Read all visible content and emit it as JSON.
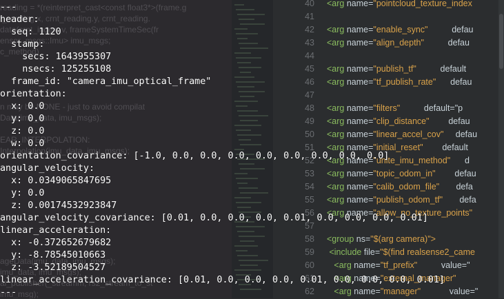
{
  "background_left_lines": [
    "reading = *(reinterpret_cast<const float3*>(frame.g",
    "t_reading.x, crnt_reading.y, crnt_reading.",
    "data(crnt_index, v, frameSystemTimeSec(fr",
    "ensor_msgs::Imu> imu_msgs;",
    "c_method)",
    "",
    "",
    "",
    "",
    "n may be NONE - just to avoid compilat",
    "Data(imu_data, imu_msgs);",
    "",
    "EAR_INTERPOLATION:",
    "Interpolation(imu_data, imu_msgs);",
    "",
    "",
    "",
    "",
    "",
    "",
    "",
    "",
    "",
    "ageData(imu_data, imu_msgs);",
    "imu_data, imu_msgs);",
    "al_publisher(_streamm, rs2_stream_to_st",
    "imu_msg);"
  ],
  "editor_right": {
    "rows": [
      {
        "n": "40",
        "parts": [
          [
            "tag",
            "<arg "
          ],
          [
            "attr",
            "name="
          ],
          [
            "val",
            "\"pointcloud_texture_index"
          ]
        ]
      },
      {
        "n": "41",
        "parts": []
      },
      {
        "n": "42",
        "parts": [
          [
            "tag",
            "<arg "
          ],
          [
            "attr",
            "name="
          ],
          [
            "val",
            "\"enable_sync\""
          ],
          [
            "attr",
            "          defau"
          ]
        ]
      },
      {
        "n": "43",
        "parts": [
          [
            "tag",
            "<arg "
          ],
          [
            "attr",
            "name="
          ],
          [
            "val",
            "\"align_depth\""
          ],
          [
            "attr",
            "          defau"
          ]
        ]
      },
      {
        "n": "44",
        "parts": []
      },
      {
        "n": "45",
        "parts": [
          [
            "tag",
            "<arg "
          ],
          [
            "attr",
            "name="
          ],
          [
            "val",
            "\"publish_tf\""
          ],
          [
            "attr",
            "          default"
          ]
        ]
      },
      {
        "n": "46",
        "parts": [
          [
            "tag",
            "<arg "
          ],
          [
            "attr",
            "name="
          ],
          [
            "val",
            "\"tf_publish_rate\""
          ],
          [
            "attr",
            "      defau"
          ]
        ]
      },
      {
        "n": "47",
        "parts": []
      },
      {
        "n": "48",
        "parts": [
          [
            "tag",
            "<arg "
          ],
          [
            "attr",
            "name="
          ],
          [
            "val",
            "\"filters\""
          ],
          [
            "attr",
            "          default=\"p"
          ]
        ]
      },
      {
        "n": "49",
        "parts": [
          [
            "tag",
            "<arg "
          ],
          [
            "attr",
            "name="
          ],
          [
            "val",
            "\"clip_distance\""
          ],
          [
            "attr",
            "        defau"
          ]
        ]
      },
      {
        "n": "50",
        "parts": [
          [
            "tag",
            "<arg "
          ],
          [
            "attr",
            "name="
          ],
          [
            "val",
            "\"linear_accel_cov\""
          ],
          [
            "attr",
            "     defau"
          ]
        ]
      },
      {
        "n": "51",
        "parts": [
          [
            "tag",
            "<arg "
          ],
          [
            "attr",
            "name="
          ],
          [
            "val",
            "\"initial_reset\""
          ],
          [
            "attr",
            "        default"
          ]
        ]
      },
      {
        "n": "52",
        "parts": [
          [
            "tag",
            "<arg "
          ],
          [
            "attr",
            "name="
          ],
          [
            "val",
            "\"unite_imu_method\""
          ],
          [
            "attr",
            "      d"
          ]
        ]
      },
      {
        "n": "53",
        "parts": [
          [
            "tag",
            "<arg "
          ],
          [
            "attr",
            "name="
          ],
          [
            "val",
            "\"topic_odom_in\""
          ],
          [
            "attr",
            "        defau"
          ]
        ]
      },
      {
        "n": "54",
        "parts": [
          [
            "tag",
            "<arg "
          ],
          [
            "attr",
            "name="
          ],
          [
            "val",
            "\"calib_odom_file\""
          ],
          [
            "attr",
            "       defa"
          ]
        ]
      },
      {
        "n": "55",
        "parts": [
          [
            "tag",
            "<arg "
          ],
          [
            "attr",
            "name="
          ],
          [
            "val",
            "\"publish_odom_tf\""
          ],
          [
            "attr",
            "       defa"
          ]
        ]
      },
      {
        "n": "56",
        "parts": [
          [
            "tag",
            "<arg "
          ],
          [
            "attr",
            "name="
          ],
          [
            "val",
            "\"allow_no_texture_points\""
          ]
        ]
      },
      {
        "n": "57",
        "parts": []
      },
      {
        "n": "58",
        "parts": [
          [
            "tag",
            "<group "
          ],
          [
            "attr",
            "ns="
          ],
          [
            "val",
            "\"$(arg camera)\">"
          ]
        ]
      },
      {
        "n": "59",
        "parts": [
          [
            "tag",
            " <include "
          ],
          [
            "attr",
            "file="
          ],
          [
            "val",
            "\"$(find realsense2_came"
          ]
        ]
      },
      {
        "n": "60",
        "parts": [
          [
            "tag",
            "   <arg "
          ],
          [
            "attr",
            "name="
          ],
          [
            "val",
            "\"tf_prefix\""
          ],
          [
            "attr",
            "          value=\""
          ]
        ]
      },
      {
        "n": "61",
        "parts": [
          [
            "tag",
            "   <arg "
          ],
          [
            "attr",
            "name="
          ],
          [
            "val",
            "\"external_manager\""
          ]
        ]
      },
      {
        "n": "62",
        "parts": [
          [
            "tag",
            "   <arg "
          ],
          [
            "attr",
            "name="
          ],
          [
            "val",
            "\"manager\""
          ],
          [
            "attr",
            "            value=\""
          ]
        ]
      }
    ]
  },
  "terminal_lines": [
    "---",
    "header:",
    "  seq: 1120",
    "  stamp:",
    "    secs: 1643955307",
    "    nsecs: 125255108",
    "  frame_id: \"camera_imu_optical_frame\"",
    "orientation:",
    "  x: 0.0",
    "  y: 0.0",
    "  z: 0.0",
    "  w: 0.0",
    "orientation_covariance: [-1.0, 0.0, 0.0, 0.0, 0.0, 0.0, 0.0, 0.0, 0.0]",
    "angular_velocity:",
    "  x: 0.0349065847695",
    "  y: 0.0",
    "  z: 0.00174532923847",
    "angular_velocity_covariance: [0.01, 0.0, 0.0, 0.0, 0.01, 0.0, 0.0, 0.0, 0.01]",
    "linear_acceleration:",
    "  x: -0.372652679682",
    "  y: -8.78545010663",
    "  z: -3.52189504527",
    "linear_acceleration_covariance: [0.01, 0.0, 0.0, 0.0, 0.01, 0.0, 0.0, 0.0, 0.01]",
    "---"
  ]
}
